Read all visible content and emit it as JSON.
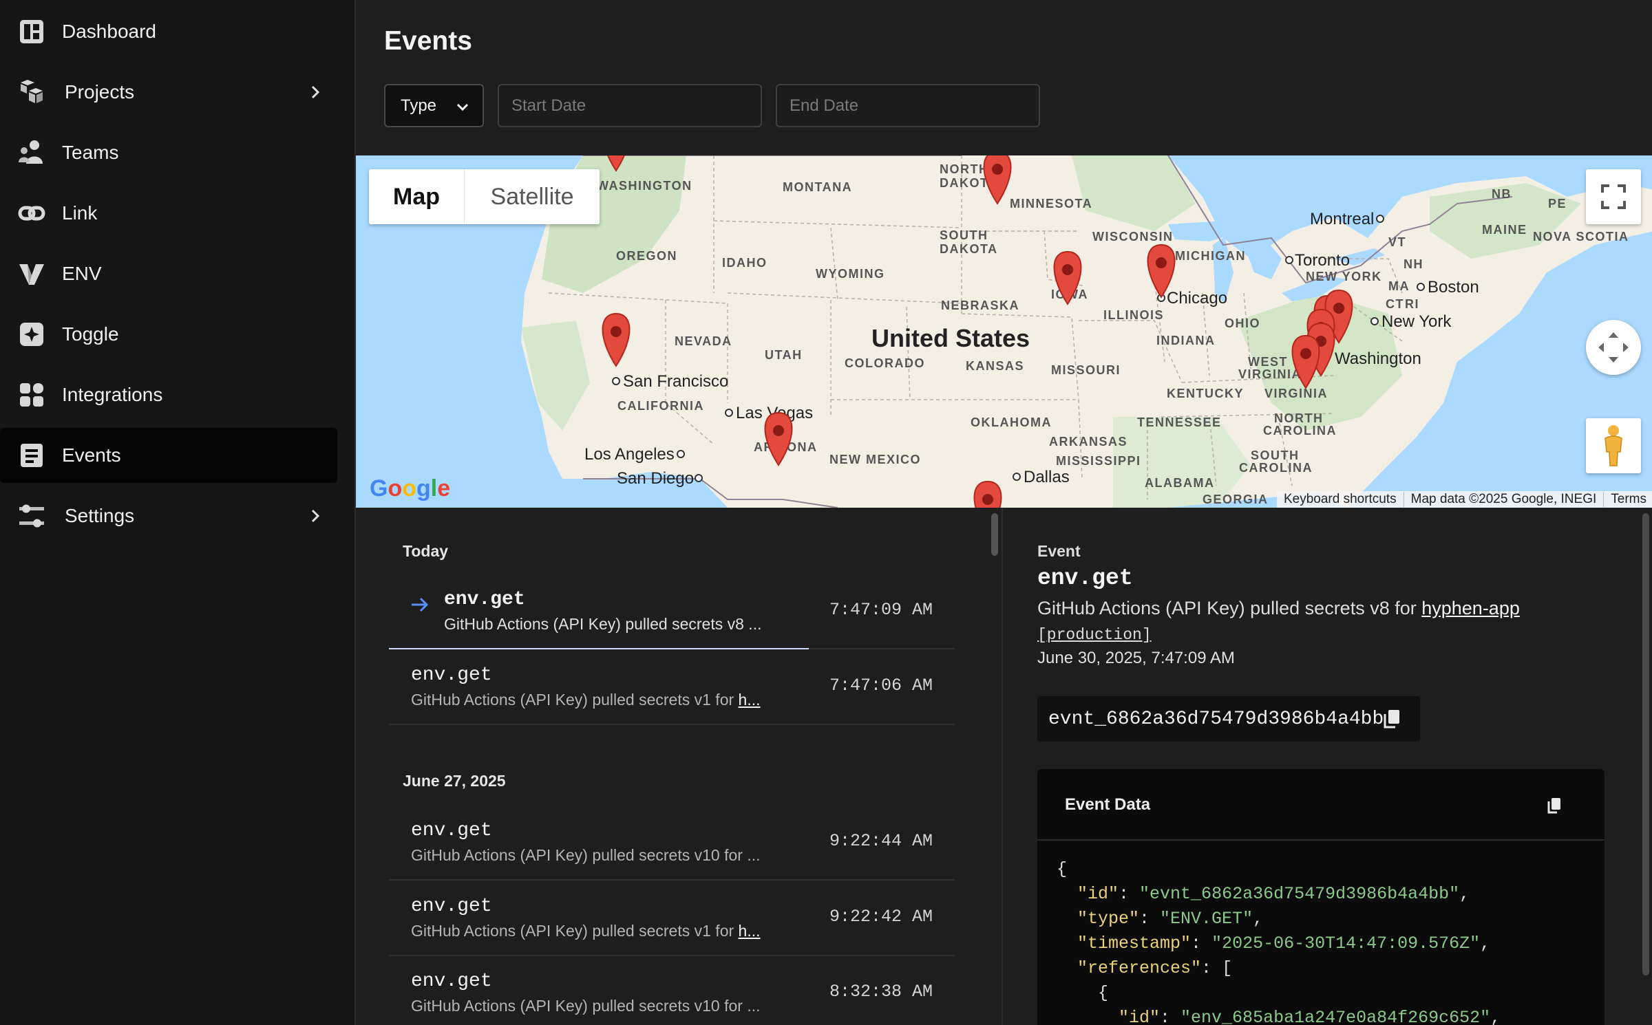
{
  "sidebar": {
    "items": [
      {
        "label": "Dashboard",
        "icon": "dashboard-icon",
        "active": false
      },
      {
        "label": "Projects",
        "icon": "projects-icon",
        "active": false,
        "has_children": true
      },
      {
        "label": "Teams",
        "icon": "teams-icon",
        "active": false
      },
      {
        "label": "Link",
        "icon": "link-icon",
        "active": false
      },
      {
        "label": "ENV",
        "icon": "env-icon",
        "active": false
      },
      {
        "label": "Toggle",
        "icon": "toggle-icon",
        "active": false
      },
      {
        "label": "Integrations",
        "icon": "integrations-icon",
        "active": false
      },
      {
        "label": "Events",
        "icon": "events-icon",
        "active": true
      },
      {
        "label": "Settings",
        "icon": "settings-icon",
        "active": false,
        "has_children": true
      }
    ]
  },
  "header": {
    "title": "Events",
    "filters": {
      "type_label": "Type",
      "start_placeholder": "Start Date",
      "end_placeholder": "End Date"
    }
  },
  "map": {
    "toggle": {
      "map": "Map",
      "satellite": "Satellite"
    },
    "country_label": "United States",
    "cities": [
      "Montreal",
      "Toronto",
      "Boston",
      "New York",
      "Washington",
      "Chicago",
      "San Francisco",
      "Las Vegas",
      "Los Angeles",
      "San Diego",
      "Dallas"
    ],
    "states": [
      "WASHINGTON",
      "MONTANA",
      "NORTH",
      "DAKOTA",
      "MINNESOTA",
      "OREGON",
      "IDAHO",
      "WYOMING",
      "SOUTH",
      "DAKOTA",
      "WISCONSIN",
      "MICHIGAN",
      "NEBRASKA",
      "IOWA",
      "ILLINOIS",
      "INDIANA",
      "OHIO",
      "NEVADA",
      "UTAH",
      "COLORADO",
      "KANSAS",
      "MISSOURI",
      "CALIFORNIA",
      "ARIZONA",
      "NEW MEXICO",
      "OKLAHOMA",
      "ARKANSAS",
      "TENNESSEE",
      "MISSISSIPPI",
      "ALABAMA",
      "GEORGIA",
      "KENTUCKY",
      "WEST",
      "VIRGINIA",
      "VIRGINIA",
      "NORTH",
      "CAROLINA",
      "SOUTH",
      "CAROLINA",
      "NEW YORK",
      "VT",
      "NH",
      "MA",
      "CT",
      "RI",
      "NB",
      "PE",
      "MAINE",
      "NOVA SCOTIA"
    ],
    "footer": {
      "shortcuts": "Keyboard shortcuts",
      "attribution": "Map data ©2025 Google, INEGI",
      "terms": "Terms"
    },
    "logo": "Google"
  },
  "events": {
    "groups": [
      {
        "label": "Today",
        "rows": [
          {
            "name": "env.get",
            "desc_text": "GitHub Actions (API Key) pulled secrets v8 ...",
            "desc_link": "",
            "time": "7:47:09 AM",
            "active": true
          },
          {
            "name": "env.get",
            "desc_text": "GitHub Actions (API Key) pulled secrets v1 for ",
            "desc_link": "h...",
            "time": "7:47:06 AM",
            "active": false
          }
        ]
      },
      {
        "label": "June 27, 2025",
        "rows": [
          {
            "name": "env.get",
            "desc_text": "GitHub Actions (API Key) pulled secrets v10 for ...",
            "desc_link": "",
            "time": "9:22:44 AM",
            "active": false
          },
          {
            "name": "env.get",
            "desc_text": "GitHub Actions (API Key) pulled secrets v1 for ",
            "desc_link": "h...",
            "time": "9:22:42 AM",
            "active": false
          },
          {
            "name": "env.get",
            "desc_text": "GitHub Actions (API Key) pulled secrets v10 for ...",
            "desc_link": "",
            "time": "8:32:38 AM",
            "active": false
          }
        ]
      }
    ]
  },
  "detail": {
    "label": "Event",
    "name": "env.get",
    "desc_prefix": "GitHub Actions (API Key) pulled secrets v8 for ",
    "app_link": "hyphen-app",
    "env_link": "[production]",
    "date": "June 30, 2025, 7:47:09 AM",
    "event_id": "evnt_6862a36d75479d3986b4a4bb",
    "data_title": "Event Data",
    "json_lines": {
      "l1": "{",
      "id_key": "\"id\"",
      "id_val": "\"evnt_6862a36d75479d3986b4a4bb\"",
      "type_key": "\"type\"",
      "type_val": "\"ENV.GET\"",
      "ts_key": "\"timestamp\"",
      "ts_val": "\"2025-06-30T14:47:09.576Z\"",
      "refs_key": "\"references\"",
      "refs_open": "[",
      "obj_open": "{",
      "ref_id_key": "\"id\"",
      "ref_id_val": "\"env_685aba1a247e0a84f269c652\""
    }
  }
}
